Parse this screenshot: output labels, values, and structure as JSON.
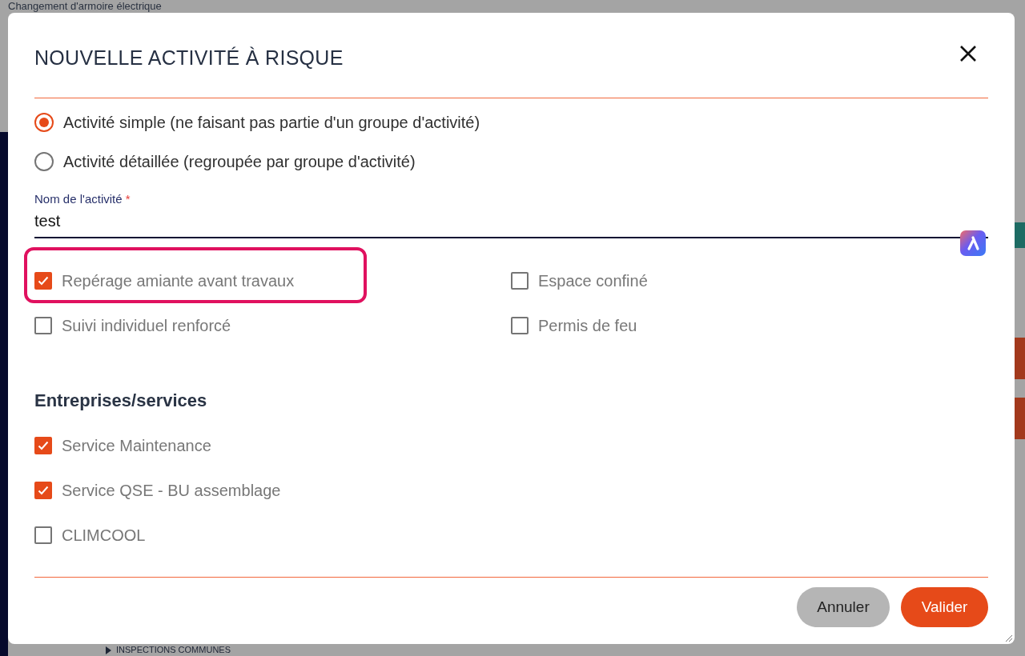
{
  "page": {
    "title": "Changement d'armoire électrique",
    "section": "INSPECTIONS COMMUNES"
  },
  "dialog": {
    "title": "NOUVELLE ACTIVITÉ À RISQUE",
    "activity_types": [
      {
        "label": "Activité simple (ne faisant pas partie d'un groupe d'activité)",
        "selected": true
      },
      {
        "label": "Activité détaillée (regroupée par groupe d'activité)",
        "selected": false
      }
    ],
    "name_field": {
      "label": "Nom de l'activité",
      "required_mark": "*",
      "value": "test"
    },
    "risks": [
      {
        "label": "Repérage amiante avant travaux",
        "checked": true,
        "highlighted": true
      },
      {
        "label": "Espace confiné",
        "checked": false,
        "highlighted": false
      },
      {
        "label": "Suivi individuel renforcé",
        "checked": false,
        "highlighted": false
      },
      {
        "label": "Permis de feu",
        "checked": false,
        "highlighted": false
      }
    ],
    "companies_heading": "Entreprises/services",
    "companies": [
      {
        "label": "Service Maintenance",
        "checked": true
      },
      {
        "label": "Service QSE - BU assemblage",
        "checked": true
      },
      {
        "label": "CLIMCOOL",
        "checked": false
      }
    ],
    "buttons": [
      {
        "label": "Annuler",
        "kind": "secondary"
      },
      {
        "label": "Valider",
        "kind": "primary"
      }
    ]
  }
}
